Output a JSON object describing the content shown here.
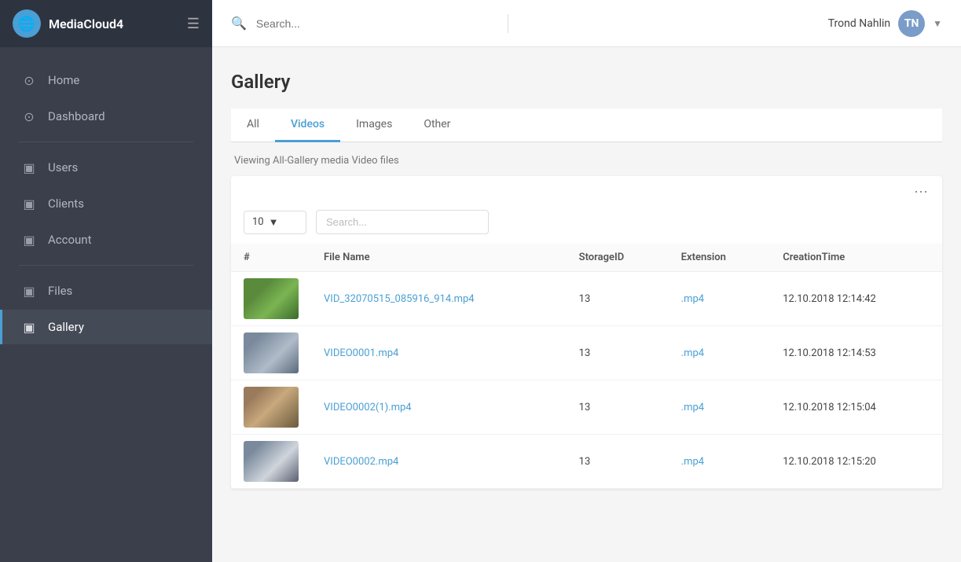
{
  "app": {
    "name": "MediaCloud4",
    "brand_icon": "🌐"
  },
  "sidebar": {
    "items": [
      {
        "id": "home",
        "label": "Home",
        "icon": "⊙",
        "active": false
      },
      {
        "id": "dashboard",
        "label": "Dashboard",
        "icon": "⊙",
        "active": false
      },
      {
        "id": "users",
        "label": "Users",
        "icon": "▣",
        "active": false
      },
      {
        "id": "clients",
        "label": "Clients",
        "icon": "▣",
        "active": false
      },
      {
        "id": "account",
        "label": "Account",
        "icon": "▣",
        "active": false
      },
      {
        "id": "files",
        "label": "Files",
        "icon": "▣",
        "active": false
      },
      {
        "id": "gallery",
        "label": "Gallery",
        "icon": "▣",
        "active": true
      }
    ]
  },
  "topbar": {
    "search_placeholder": "Search...",
    "username": "Trond Nahlin",
    "avatar_initials": "TN"
  },
  "page": {
    "title": "Gallery",
    "status_text": "Viewing All-Gallery media Video files"
  },
  "tabs": [
    {
      "id": "all",
      "label": "All",
      "active": false
    },
    {
      "id": "videos",
      "label": "Videos",
      "active": true
    },
    {
      "id": "images",
      "label": "Images",
      "active": false
    },
    {
      "id": "other",
      "label": "Other",
      "active": false
    }
  ],
  "table": {
    "per_page_value": "10",
    "search_placeholder": "Search...",
    "columns": [
      "#",
      "File Name",
      "StorageID",
      "Extension",
      "CreationTime"
    ],
    "rows": [
      {
        "id": 1,
        "thumb_class": "thumb-1",
        "file_name": "VID_32070515_085916_914.mp4",
        "storage_id": "13",
        "extension": ".mp4",
        "creation_time": "12.10.2018 12:14:42"
      },
      {
        "id": 2,
        "thumb_class": "thumb-2",
        "file_name": "VIDEO0001.mp4",
        "storage_id": "13",
        "extension": ".mp4",
        "creation_time": "12.10.2018 12:14:53"
      },
      {
        "id": 3,
        "thumb_class": "thumb-3",
        "file_name": "VIDEO0002(1).mp4",
        "storage_id": "13",
        "extension": ".mp4",
        "creation_time": "12.10.2018 12:15:04"
      },
      {
        "id": 4,
        "thumb_class": "thumb-4",
        "file_name": "VIDEO0002.mp4",
        "storage_id": "13",
        "extension": ".mp4",
        "creation_time": "12.10.2018 12:15:20"
      }
    ]
  }
}
